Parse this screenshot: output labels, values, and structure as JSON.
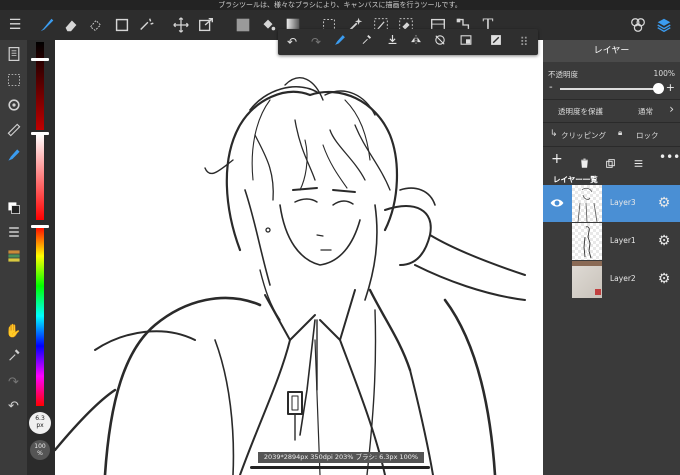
{
  "status_bar": {
    "message": "ブラシツールは、様々なブラシにより、キャンバスに描画を行うツールです。"
  },
  "toolbar": {
    "tools": [
      {
        "name": "brush"
      },
      {
        "name": "eraser"
      },
      {
        "name": "lasso-eraser"
      },
      {
        "name": "select-rect"
      },
      {
        "name": "select-magic"
      },
      {
        "name": "move"
      },
      {
        "name": "transform"
      },
      {
        "name": "fill-color"
      },
      {
        "name": "bucket"
      },
      {
        "name": "gradient"
      },
      {
        "name": "dotted-select"
      },
      {
        "name": "magic-wand"
      },
      {
        "name": "select-pen"
      },
      {
        "name": "select-eraser"
      },
      {
        "name": "frame"
      },
      {
        "name": "panel-divide"
      },
      {
        "name": "text"
      }
    ],
    "text_tool_label": "T"
  },
  "subbar": {
    "items": [
      "undo",
      "redo",
      "brush-settings",
      "eyedropper",
      "import",
      "flip",
      "snap-off",
      "layer-panel",
      "tone",
      "grid"
    ]
  },
  "brush_size": {
    "value": "6.3",
    "unit": "px"
  },
  "brush_opacity": {
    "value": "100",
    "unit": "%"
  },
  "canvas_info": {
    "text": "2039*2894px 350dpi 203% ブラシ: 6.3px 100%"
  },
  "colors": {
    "accent": "#2f8be0",
    "selected_layer": "#4a8fd4",
    "canvas": "#ffffff"
  },
  "layers_panel": {
    "title": "レイヤー",
    "opacity_label": "不透明度",
    "opacity_value": "100%",
    "opacity_fraction": 1.0,
    "minus": "-",
    "plus": "+",
    "protect_alpha": "透明度を保護",
    "blend_mode": "通常",
    "clipping": "クリッピング",
    "lock": "ロック",
    "list_title": "レイヤー一覧",
    "layers": [
      {
        "name": "Layer3",
        "selected": true,
        "visible": true
      },
      {
        "name": "Layer1",
        "selected": false,
        "visible": true
      },
      {
        "name": "Layer2",
        "selected": false,
        "visible": true
      }
    ]
  }
}
